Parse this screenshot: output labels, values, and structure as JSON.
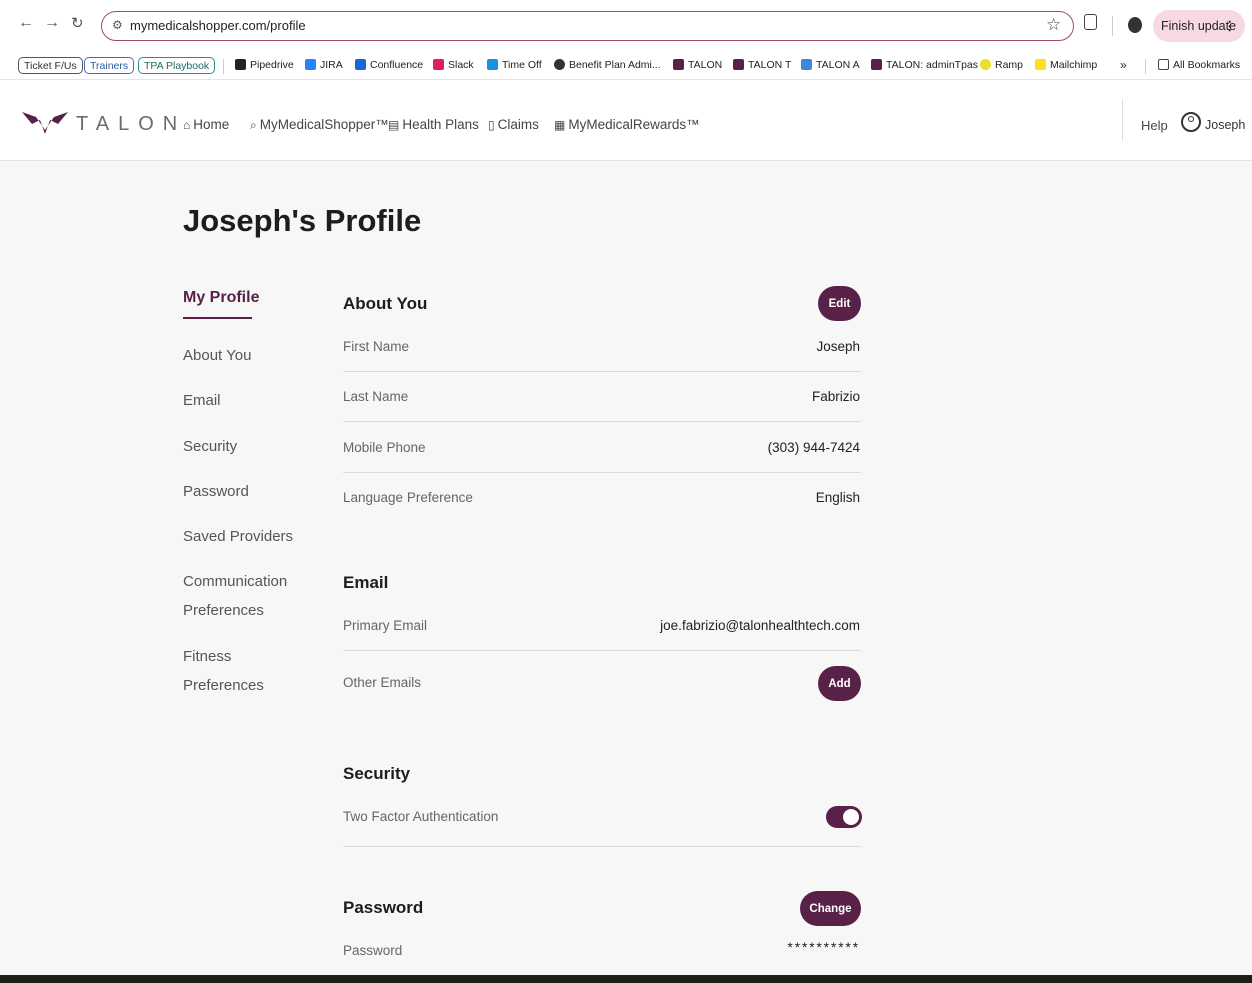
{
  "browser": {
    "url": "mymedicalshopper.com/profile",
    "finish_update": "Finish update",
    "bookmarks": {
      "chips": [
        "Ticket F/Us",
        "Trainers",
        "TPA Playbook"
      ],
      "items": [
        "Pipedrive",
        "JIRA",
        "Confluence",
        "Slack",
        "Time Off",
        "Benefit Plan Admi...",
        "TALON",
        "TALON T",
        "TALON A",
        "TALON: adminTpas",
        "Ramp",
        "Mailchimp"
      ],
      "overflow": "»",
      "all": "All Bookmarks"
    }
  },
  "header": {
    "logo": "TALON",
    "nav": [
      "Home",
      "MyMedicalShopper™",
      "Health Plans",
      "Claims",
      "MyMedicalRewards™"
    ],
    "help": "Help",
    "user": "Joseph"
  },
  "page": {
    "title": "Joseph's Profile",
    "sidebar": {
      "heading": "My Profile",
      "items": [
        "About You",
        "Email",
        "Security",
        "Password",
        "Saved Providers",
        "Communication Preferences",
        "Fitness Preferences"
      ]
    },
    "about": {
      "title": "About You",
      "edit": "Edit",
      "rows": [
        {
          "label": "First Name",
          "value": "Joseph"
        },
        {
          "label": "Last Name",
          "value": "Fabrizio"
        },
        {
          "label": "Mobile Phone",
          "value": "(303) 944-7424"
        },
        {
          "label": "Language Preference",
          "value": "English"
        }
      ]
    },
    "email": {
      "title": "Email",
      "primary_label": "Primary Email",
      "primary_value": "joe.fabrizio@talonhealthtech.com",
      "other_label": "Other Emails",
      "add": "Add"
    },
    "security": {
      "title": "Security",
      "tfa_label": "Two Factor Authentication",
      "tfa_enabled": true
    },
    "password": {
      "title": "Password",
      "change": "Change",
      "label": "Password",
      "value": "**********"
    }
  },
  "colors": {
    "accent": "#5a2148",
    "url_border": "#9a4b6e",
    "finish_bg": "#f6d9e2"
  }
}
